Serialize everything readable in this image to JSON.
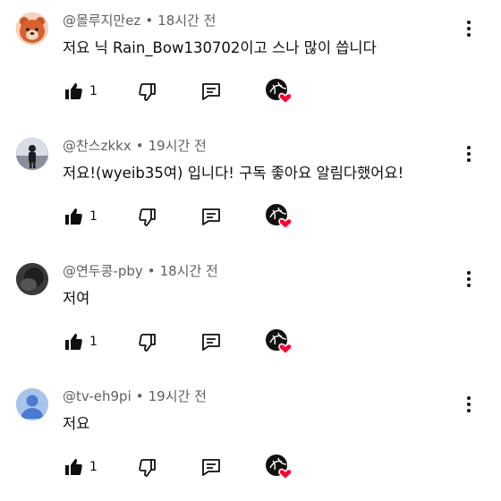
{
  "comments": [
    {
      "author": "@몰루지만ez",
      "time": "18시간 전",
      "text": "저요 닉 Rain_Bow130702이고 스나 많이 씁니다",
      "likes": "1",
      "avatar_color": "#e8643c",
      "avatar_kind": "bear-face"
    },
    {
      "author": "@찬스zkkx",
      "time": "19시간 전",
      "text": "저요!(wyeib35여) 입니다! 구독 좋아요 알림다했어요!",
      "likes": "1",
      "avatar_color": "#3b3f52",
      "avatar_kind": "figure-photo"
    },
    {
      "author": "@연두콩-pby",
      "time": "18시간 전",
      "text": "저여",
      "likes": "1",
      "avatar_color": "#2e2e2e",
      "avatar_kind": "dark-photo"
    },
    {
      "author": "@tv-eh9pi",
      "time": "19시간 전",
      "text": "저요",
      "likes": "1",
      "avatar_color": "#a9c4ea",
      "avatar_kind": "default-person"
    }
  ],
  "separator": "•",
  "icons": {
    "like": "thumbs-up-icon",
    "dislike": "thumbs-down-icon",
    "reply": "reply-icon",
    "creator_heart": "creator-heart-badge",
    "menu": "more-vertical-icon"
  },
  "colors": {
    "heart": "#ff0033",
    "meta_text": "#606060",
    "body_text": "#0f0f0f"
  }
}
